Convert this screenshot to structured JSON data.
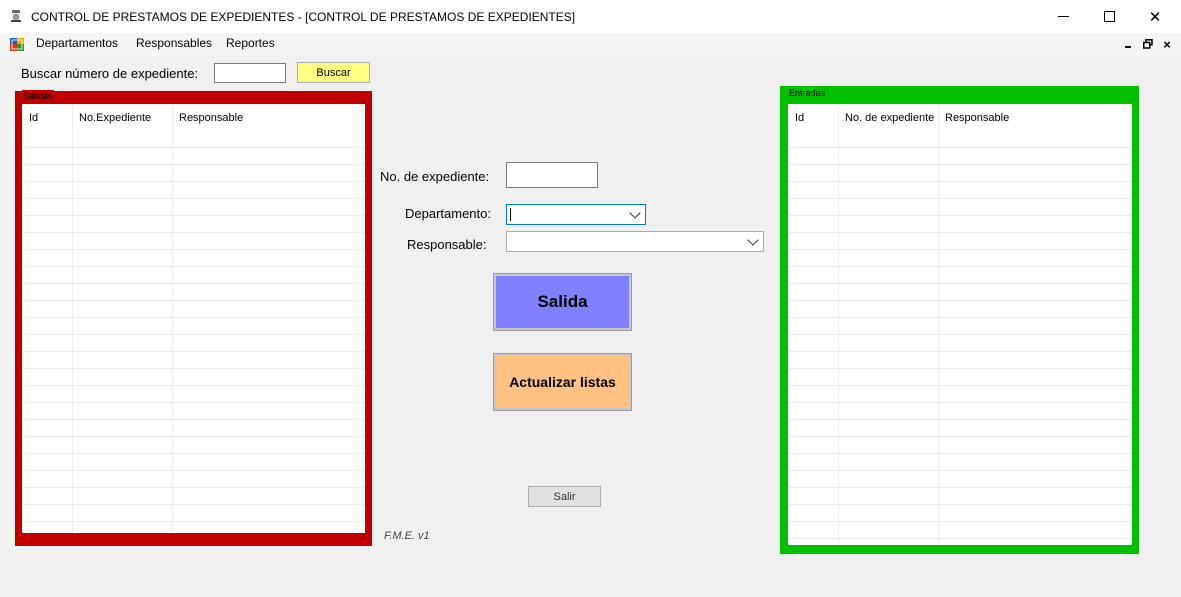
{
  "window": {
    "title": "CONTROL DE PRESTAMOS DE EXPEDIENTES - [CONTROL DE PRESTAMOS DE EXPEDIENTES]",
    "minimize_glyph": "",
    "maximize_glyph": "",
    "close_glyph": "✕"
  },
  "menu": {
    "items": [
      "Departamentos",
      "Responsables",
      "Reportes"
    ],
    "mdi_close_glyph": "×"
  },
  "search": {
    "label": "Buscar número de expediente:",
    "value": "",
    "button_label": "Buscar",
    "button_color": "#ffff80"
  },
  "salidas": {
    "legend": "Salidas",
    "frame_color": "#c00000",
    "columns": [
      "Id",
      "No.Expediente",
      "Responsable"
    ],
    "rows": []
  },
  "entradas": {
    "legend": "Entradas",
    "frame_color": "#00c000",
    "columns": [
      "Id",
      "No. de expediente",
      "Responsable"
    ],
    "rows": []
  },
  "form": {
    "expediente_label": "No. de expediente:",
    "expediente_value": "",
    "departamento_label": "Departamento:",
    "departamento_value": "",
    "responsable_label": "Responsable:",
    "responsable_value": "",
    "salida_label": "Salida",
    "salida_color": "#8080ff",
    "actualizar_label": "Actualizar listas",
    "actualizar_color": "#ffc080",
    "salir_label": "Salir"
  },
  "footer": {
    "version": "F.M.E. v1"
  },
  "icons": {
    "app": "app-logo-icon",
    "mdi": "mdi-window-icon",
    "dropdown": "chevron-down-icon"
  }
}
